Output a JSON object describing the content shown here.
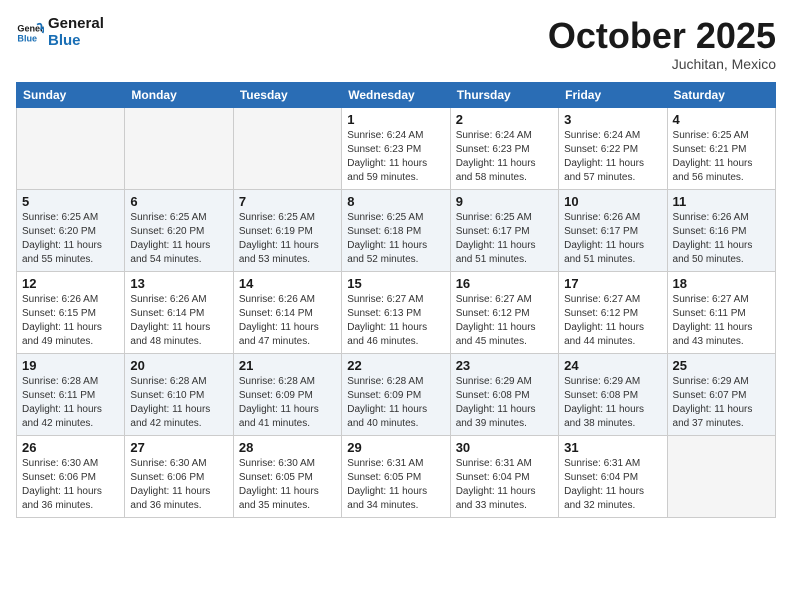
{
  "logo": {
    "text_general": "General",
    "text_blue": "Blue"
  },
  "header": {
    "month": "October 2025",
    "location": "Juchitan, Mexico"
  },
  "weekdays": [
    "Sunday",
    "Monday",
    "Tuesday",
    "Wednesday",
    "Thursday",
    "Friday",
    "Saturday"
  ],
  "weeks": [
    [
      {
        "day": "",
        "empty": true
      },
      {
        "day": "",
        "empty": true
      },
      {
        "day": "",
        "empty": true
      },
      {
        "day": "1",
        "sunrise": "Sunrise: 6:24 AM",
        "sunset": "Sunset: 6:23 PM",
        "daylight": "Daylight: 11 hours and 59 minutes."
      },
      {
        "day": "2",
        "sunrise": "Sunrise: 6:24 AM",
        "sunset": "Sunset: 6:23 PM",
        "daylight": "Daylight: 11 hours and 58 minutes."
      },
      {
        "day": "3",
        "sunrise": "Sunrise: 6:24 AM",
        "sunset": "Sunset: 6:22 PM",
        "daylight": "Daylight: 11 hours and 57 minutes."
      },
      {
        "day": "4",
        "sunrise": "Sunrise: 6:25 AM",
        "sunset": "Sunset: 6:21 PM",
        "daylight": "Daylight: 11 hours and 56 minutes."
      }
    ],
    [
      {
        "day": "5",
        "sunrise": "Sunrise: 6:25 AM",
        "sunset": "Sunset: 6:20 PM",
        "daylight": "Daylight: 11 hours and 55 minutes."
      },
      {
        "day": "6",
        "sunrise": "Sunrise: 6:25 AM",
        "sunset": "Sunset: 6:20 PM",
        "daylight": "Daylight: 11 hours and 54 minutes."
      },
      {
        "day": "7",
        "sunrise": "Sunrise: 6:25 AM",
        "sunset": "Sunset: 6:19 PM",
        "daylight": "Daylight: 11 hours and 53 minutes."
      },
      {
        "day": "8",
        "sunrise": "Sunrise: 6:25 AM",
        "sunset": "Sunset: 6:18 PM",
        "daylight": "Daylight: 11 hours and 52 minutes."
      },
      {
        "day": "9",
        "sunrise": "Sunrise: 6:25 AM",
        "sunset": "Sunset: 6:17 PM",
        "daylight": "Daylight: 11 hours and 51 minutes."
      },
      {
        "day": "10",
        "sunrise": "Sunrise: 6:26 AM",
        "sunset": "Sunset: 6:17 PM",
        "daylight": "Daylight: 11 hours and 51 minutes."
      },
      {
        "day": "11",
        "sunrise": "Sunrise: 6:26 AM",
        "sunset": "Sunset: 6:16 PM",
        "daylight": "Daylight: 11 hours and 50 minutes."
      }
    ],
    [
      {
        "day": "12",
        "sunrise": "Sunrise: 6:26 AM",
        "sunset": "Sunset: 6:15 PM",
        "daylight": "Daylight: 11 hours and 49 minutes."
      },
      {
        "day": "13",
        "sunrise": "Sunrise: 6:26 AM",
        "sunset": "Sunset: 6:14 PM",
        "daylight": "Daylight: 11 hours and 48 minutes."
      },
      {
        "day": "14",
        "sunrise": "Sunrise: 6:26 AM",
        "sunset": "Sunset: 6:14 PM",
        "daylight": "Daylight: 11 hours and 47 minutes."
      },
      {
        "day": "15",
        "sunrise": "Sunrise: 6:27 AM",
        "sunset": "Sunset: 6:13 PM",
        "daylight": "Daylight: 11 hours and 46 minutes."
      },
      {
        "day": "16",
        "sunrise": "Sunrise: 6:27 AM",
        "sunset": "Sunset: 6:12 PM",
        "daylight": "Daylight: 11 hours and 45 minutes."
      },
      {
        "day": "17",
        "sunrise": "Sunrise: 6:27 AM",
        "sunset": "Sunset: 6:12 PM",
        "daylight": "Daylight: 11 hours and 44 minutes."
      },
      {
        "day": "18",
        "sunrise": "Sunrise: 6:27 AM",
        "sunset": "Sunset: 6:11 PM",
        "daylight": "Daylight: 11 hours and 43 minutes."
      }
    ],
    [
      {
        "day": "19",
        "sunrise": "Sunrise: 6:28 AM",
        "sunset": "Sunset: 6:11 PM",
        "daylight": "Daylight: 11 hours and 42 minutes."
      },
      {
        "day": "20",
        "sunrise": "Sunrise: 6:28 AM",
        "sunset": "Sunset: 6:10 PM",
        "daylight": "Daylight: 11 hours and 42 minutes."
      },
      {
        "day": "21",
        "sunrise": "Sunrise: 6:28 AM",
        "sunset": "Sunset: 6:09 PM",
        "daylight": "Daylight: 11 hours and 41 minutes."
      },
      {
        "day": "22",
        "sunrise": "Sunrise: 6:28 AM",
        "sunset": "Sunset: 6:09 PM",
        "daylight": "Daylight: 11 hours and 40 minutes."
      },
      {
        "day": "23",
        "sunrise": "Sunrise: 6:29 AM",
        "sunset": "Sunset: 6:08 PM",
        "daylight": "Daylight: 11 hours and 39 minutes."
      },
      {
        "day": "24",
        "sunrise": "Sunrise: 6:29 AM",
        "sunset": "Sunset: 6:08 PM",
        "daylight": "Daylight: 11 hours and 38 minutes."
      },
      {
        "day": "25",
        "sunrise": "Sunrise: 6:29 AM",
        "sunset": "Sunset: 6:07 PM",
        "daylight": "Daylight: 11 hours and 37 minutes."
      }
    ],
    [
      {
        "day": "26",
        "sunrise": "Sunrise: 6:30 AM",
        "sunset": "Sunset: 6:06 PM",
        "daylight": "Daylight: 11 hours and 36 minutes."
      },
      {
        "day": "27",
        "sunrise": "Sunrise: 6:30 AM",
        "sunset": "Sunset: 6:06 PM",
        "daylight": "Daylight: 11 hours and 36 minutes."
      },
      {
        "day": "28",
        "sunrise": "Sunrise: 6:30 AM",
        "sunset": "Sunset: 6:05 PM",
        "daylight": "Daylight: 11 hours and 35 minutes."
      },
      {
        "day": "29",
        "sunrise": "Sunrise: 6:31 AM",
        "sunset": "Sunset: 6:05 PM",
        "daylight": "Daylight: 11 hours and 34 minutes."
      },
      {
        "day": "30",
        "sunrise": "Sunrise: 6:31 AM",
        "sunset": "Sunset: 6:04 PM",
        "daylight": "Daylight: 11 hours and 33 minutes."
      },
      {
        "day": "31",
        "sunrise": "Sunrise: 6:31 AM",
        "sunset": "Sunset: 6:04 PM",
        "daylight": "Daylight: 11 hours and 32 minutes."
      },
      {
        "day": "",
        "empty": true
      }
    ]
  ]
}
